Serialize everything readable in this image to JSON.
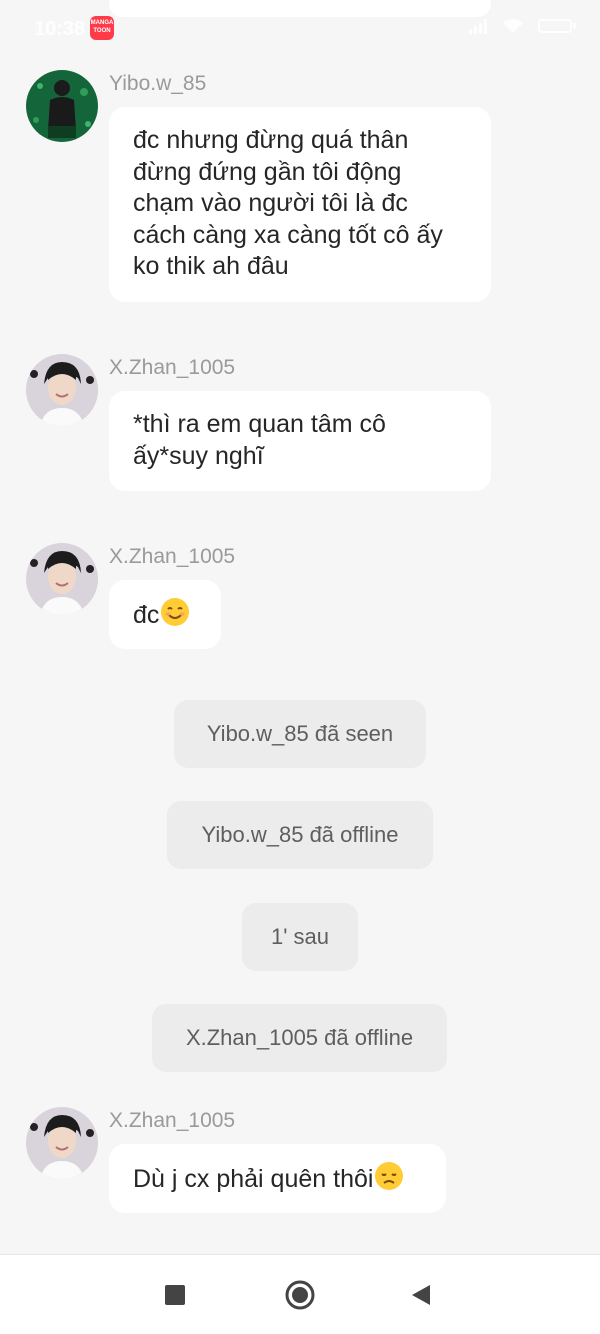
{
  "status": {
    "time": "10:38",
    "app_badge": "MANGA TOON"
  },
  "messages": [
    {
      "sender": "Yibo.w_85",
      "lines": [
        "đc nhưng đừng quá thân",
        "đừng đứng gần tôi động",
        "chạm vào người tôi là đc",
        "cách càng xa càng tốt cô ấy",
        "ko thik ah đâu"
      ]
    },
    {
      "sender": "X.Zhan_1005",
      "lines": [
        "*thì ra em quan tâm cô",
        "ấy*suy nghĩ"
      ]
    },
    {
      "sender": "X.Zhan_1005",
      "text": "đc",
      "emoji": "smiling-face-icon"
    },
    {
      "sender": "X.Zhan_1005",
      "text": "Dù j cx phải quên thôi",
      "emoji": "disappointed-face-icon"
    }
  ],
  "system_messages": [
    "Yibo.w_85 đã seen",
    "Yibo.w_85 đã offline",
    "1' sau",
    "X.Zhan_1005 đã offline"
  ],
  "nav": {
    "recent": "recent-apps-icon",
    "home": "home-icon",
    "back": "back-icon"
  }
}
